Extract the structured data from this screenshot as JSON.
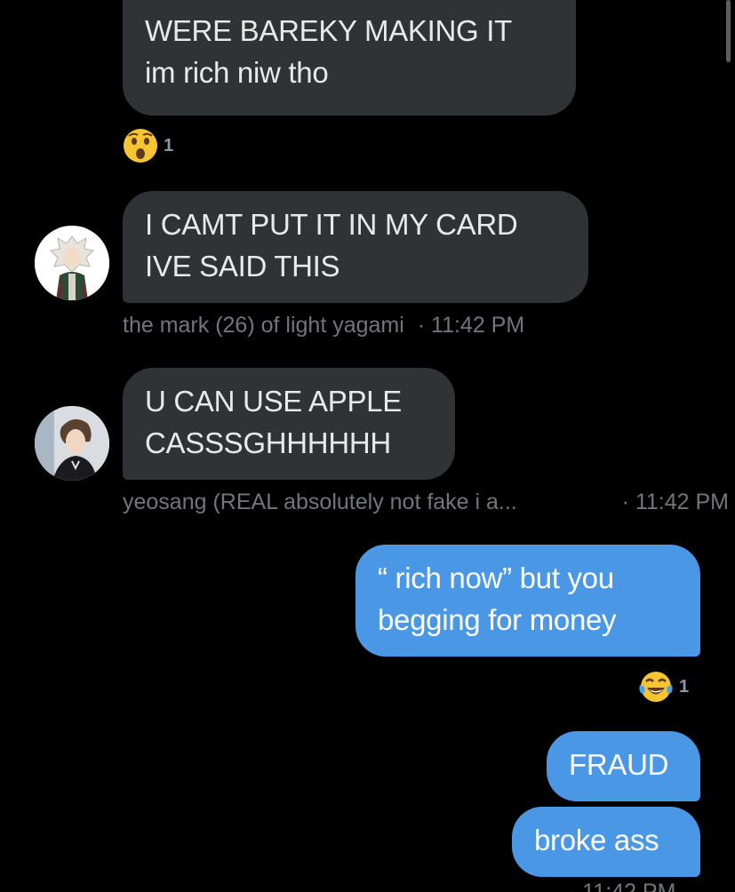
{
  "messages": [
    {
      "text": "NIT RIVH BACK THEN WE\nWERE BAREKY MAKING IT\nim rich niw tho",
      "reaction": {
        "emoji": "astonished-face",
        "count": "1"
      }
    },
    {
      "text": "I CAMT PUT IT IN MY CARD\nIVE SAID THIS",
      "sender": "the mark (26) of light yagami",
      "time": "· 11:42 PM"
    },
    {
      "text": "U CAN USE APPLE\nCASSSGHHHHHH",
      "sender": "yeosang (REAL absolutely not fake i a...",
      "time": "· 11:42 PM"
    },
    {
      "text": "“ rich now” but you\nbegging for money",
      "reaction": {
        "emoji": "face-with-tears-of-joy",
        "count": "1"
      }
    },
    {
      "text": "FRAUD"
    },
    {
      "text": "broke ass"
    }
  ],
  "colors": {
    "background": "#000000",
    "incoming_bubble": "#2f3336",
    "outgoing_bubble": "#4a97e6",
    "meta_text": "#71767b"
  }
}
